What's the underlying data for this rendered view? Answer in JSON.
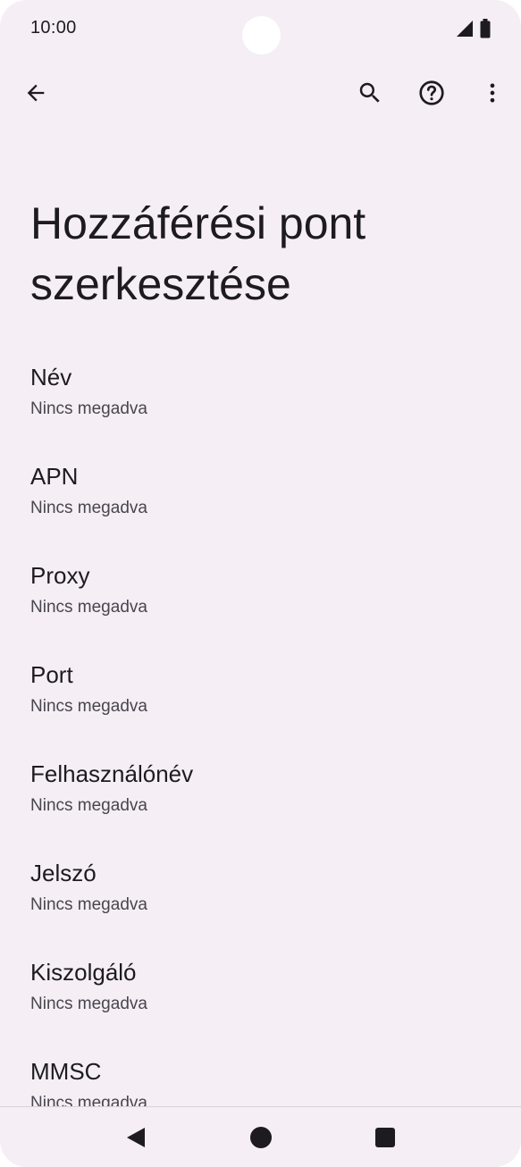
{
  "status_bar": {
    "time": "10:00",
    "icons": [
      "signal-icon",
      "battery-icon"
    ]
  },
  "toolbar": {
    "back_icon": "arrow-left-icon",
    "actions": [
      "search-icon",
      "help-icon",
      "more-vert-icon"
    ]
  },
  "page": {
    "title": "Hozzáférési pont szerkesztése"
  },
  "settings": [
    {
      "title": "Név",
      "summary": "Nincs megadva"
    },
    {
      "title": "APN",
      "summary": "Nincs megadva"
    },
    {
      "title": "Proxy",
      "summary": "Nincs megadva"
    },
    {
      "title": "Port",
      "summary": "Nincs megadva"
    },
    {
      "title": "Felhasználónév",
      "summary": "Nincs megadva"
    },
    {
      "title": "Jelszó",
      "summary": "Nincs megadva"
    },
    {
      "title": "Kiszolgáló",
      "summary": "Nincs megadva"
    },
    {
      "title": "MMSC",
      "summary": "Nincs megadva"
    }
  ],
  "nav_bar": {
    "buttons": [
      "nav-back-icon",
      "nav-home-icon",
      "nav-recents-icon"
    ]
  },
  "colors": {
    "background": "#f5eef5",
    "text_primary": "#1d1b20",
    "text_secondary": "#49454f"
  }
}
